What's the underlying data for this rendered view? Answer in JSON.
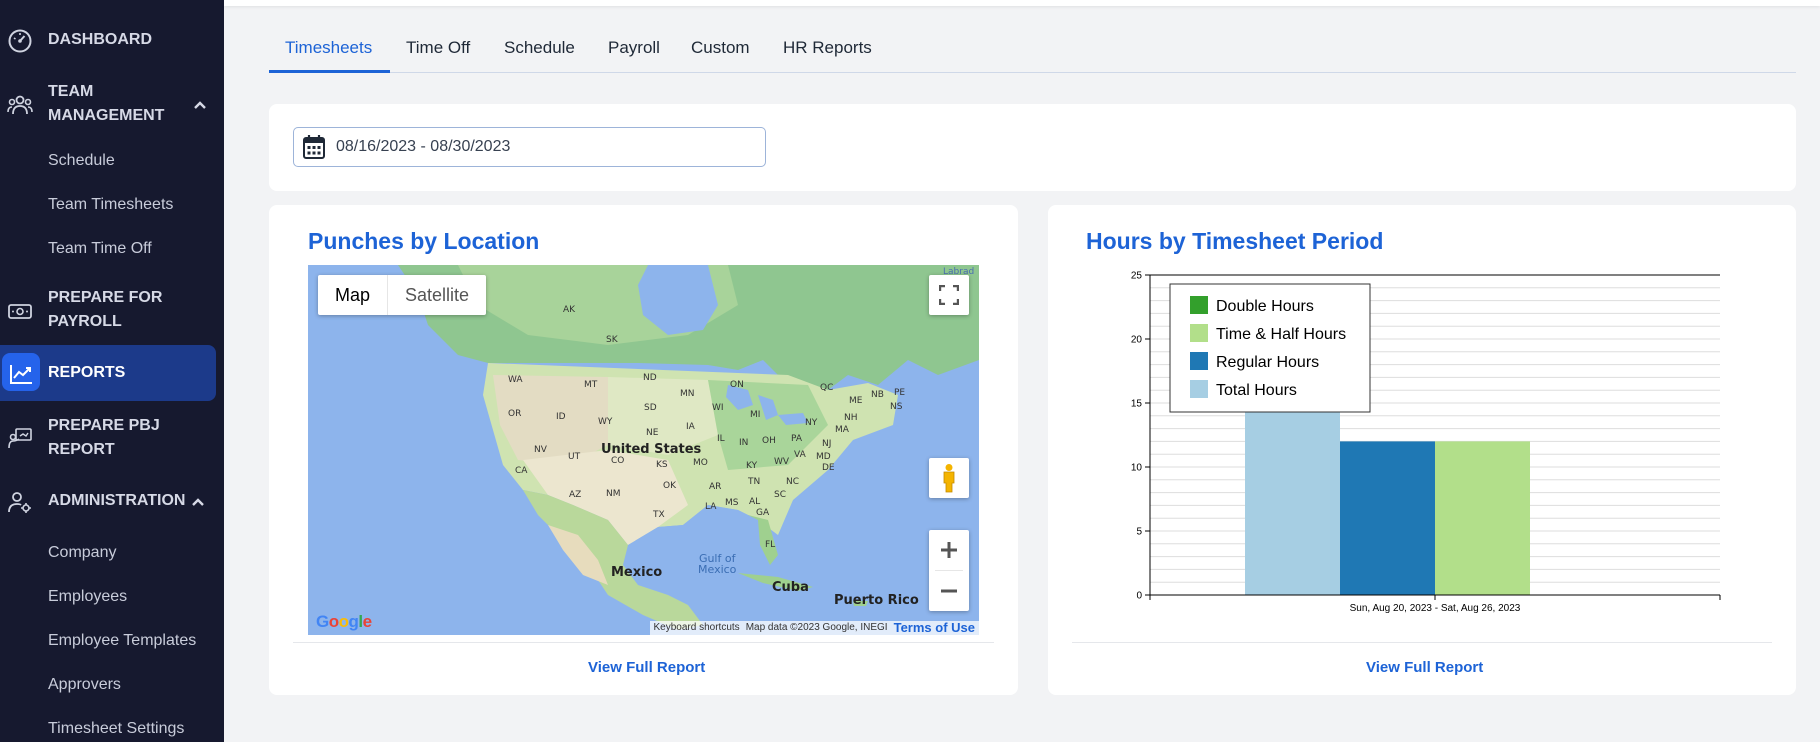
{
  "sidebar": {
    "dashboard": "DASHBOARD",
    "team_management_line1": "TEAM",
    "team_management_line2": "MANAGEMENT",
    "team_sub": [
      "Schedule",
      "Team Timesheets",
      "Team Time Off"
    ],
    "payroll_line1": "PREPARE FOR",
    "payroll_line2": "PAYROLL",
    "reports": "REPORTS",
    "pbj_line1": "PREPARE PBJ",
    "pbj_line2": "REPORT",
    "administration": "ADMINISTRATION",
    "admin_sub": [
      "Company",
      "Employees",
      "Employee Templates",
      "Approvers",
      "Timesheet Settings"
    ]
  },
  "tabs": [
    "Timesheets",
    "Time Off",
    "Schedule",
    "Payroll",
    "Custom",
    "HR Reports"
  ],
  "active_tab": "Timesheets",
  "date_range": "08/16/2023 - 08/30/2023",
  "map_card": {
    "title": "Punches by Location",
    "map_option_map": "Map",
    "map_option_satellite": "Satellite",
    "labels": {
      "united_states": "United States",
      "mexico": "Mexico",
      "cuba": "Cuba",
      "puerto_rico": "Puerto Rico",
      "gulf_1": "Gulf of",
      "gulf_2": "Mexico",
      "labrador": "Labrad",
      "states": [
        "AK",
        "SK",
        "ON",
        "QC",
        "WA",
        "MT",
        "ND",
        "MN",
        "ME",
        "NB",
        "PE",
        "NS",
        "OR",
        "ID",
        "WY",
        "SD",
        "WI",
        "MI",
        "NY",
        "NH",
        "MA",
        "NE",
        "IA",
        "IL",
        "IN",
        "OH",
        "PA",
        "NJ",
        "NV",
        "UT",
        "CO",
        "KS",
        "MO",
        "KY",
        "WV",
        "VA",
        "MD",
        "DE",
        "CA",
        "AZ",
        "NM",
        "OK",
        "AR",
        "TN",
        "NC",
        "TX",
        "LA",
        "MS",
        "AL",
        "GA",
        "SC",
        "FL"
      ]
    },
    "attribution": [
      "Keyboard shortcuts",
      "Map data ©2023 Google, INEGI",
      "Terms of Use"
    ],
    "google_logo": "Google",
    "link": "View Full Report"
  },
  "chart_card": {
    "title": "Hours by Timesheet Period",
    "link": "View Full Report"
  },
  "chart_data": {
    "type": "bar",
    "categories": [
      "Sun, Aug 20, 2023 - Sat, Aug 26, 2023"
    ],
    "series": [
      {
        "name": "Double Hours",
        "values": [
          0
        ],
        "color": "#33a02c"
      },
      {
        "name": "Time & Half Hours",
        "values": [
          12
        ],
        "color": "#b2df8a"
      },
      {
        "name": "Regular Hours",
        "values": [
          12
        ],
        "color": "#1f78b4"
      },
      {
        "name": "Total Hours",
        "values": [
          24
        ],
        "color": "#a6cee3"
      }
    ],
    "ylim": [
      0,
      25
    ],
    "yticks": [
      "0",
      "5",
      "10",
      "15",
      "20",
      "25"
    ],
    "grid": true,
    "legend": "top-left"
  },
  "colors": {
    "accent": "#1d63d6",
    "sidebar": "#16192f",
    "active": "#1c3a8a"
  }
}
